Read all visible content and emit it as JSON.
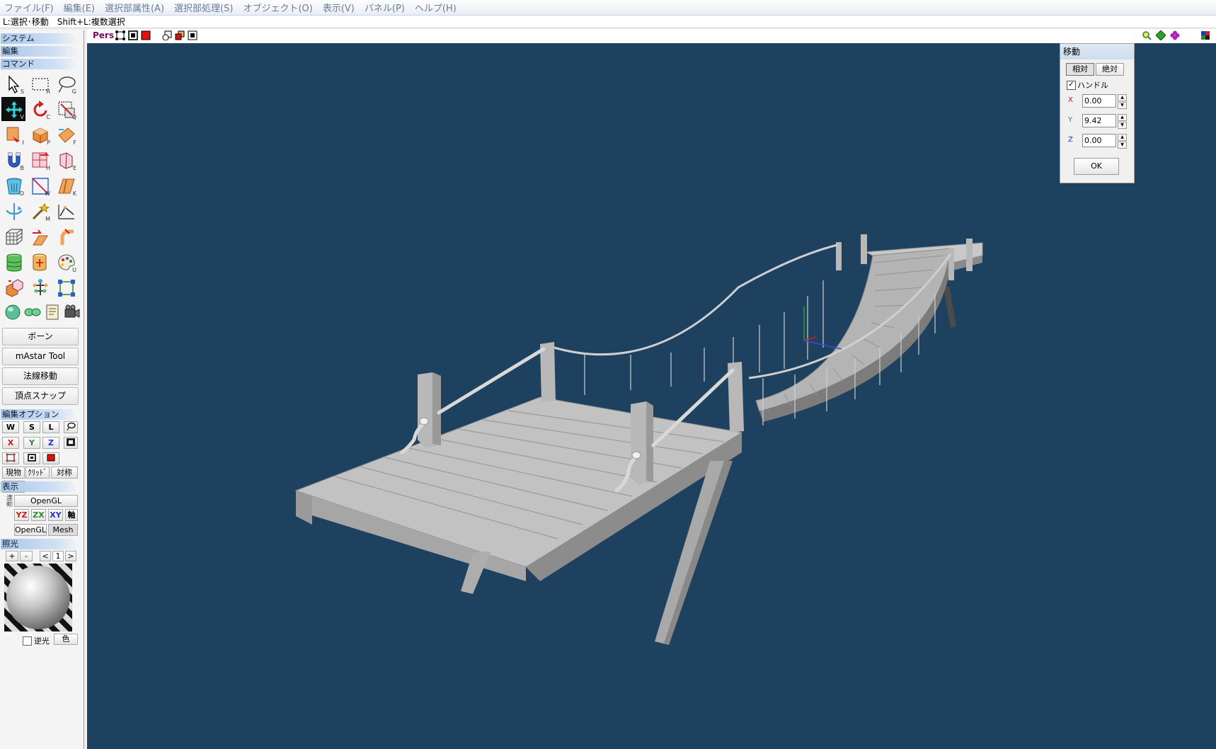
{
  "menu": [
    "ファイル(F)",
    "編集(E)",
    "選択部属性(A)",
    "選択部処理(S)",
    "オブジェクト(O)",
    "表示(V)",
    "パネル(P)",
    "ヘルプ(H)"
  ],
  "status_hint": "L:選択･移動　Shift+L:複数選択",
  "panel": {
    "system": "システム",
    "edit": "編集",
    "command": "コマンド",
    "tool_keys": [
      "S",
      "R",
      "G",
      "V",
      "C",
      "Q",
      "I",
      "P",
      "F",
      "B",
      "H",
      "E",
      "D",
      "W",
      "K",
      "",
      "M",
      "",
      "",
      "",
      "",
      "",
      "",
      "U",
      "",
      "",
      "",
      ""
    ],
    "buttons": [
      "ボーン",
      "mAstar Tool",
      "法線移動",
      "頂点スナップ"
    ],
    "edit_options": "編集オプション",
    "opt_row1": [
      "W",
      "S",
      "L"
    ],
    "opt_row2": [
      "X",
      "Y",
      "Z"
    ],
    "opt_row4": [
      "現物",
      "ｸﾘｯﾄﾞ",
      "対称"
    ],
    "display": "表示",
    "display_side": "連動",
    "display_opengl": "OpenGL",
    "display_planes": [
      "YZ",
      "ZX",
      "XY",
      "軸"
    ],
    "display_modes": [
      "OpenGL",
      "Mesh"
    ],
    "lighting": "照光",
    "light_controls": [
      "+",
      "-",
      "<",
      "1",
      ">"
    ],
    "backlight": "逆光",
    "color": "色"
  },
  "viewport": {
    "mode_label": "Pers"
  },
  "move_dialog": {
    "title": "移動",
    "relative": "相対",
    "absolute": "絶対",
    "handle_label": "ハンドル",
    "handle_checked": true,
    "x_label": "X",
    "x_value": "0.00",
    "y_label": "Y",
    "y_value": "9.42",
    "z_label": "Z",
    "z_value": "0.00",
    "ok": "OK"
  },
  "colors": {
    "viewport_bg": "#1f4160",
    "accent_blue": "#a9c6e8",
    "axis_x": "#d01818",
    "axis_y": "#2a8a2a",
    "axis_z": "#2233cc"
  }
}
